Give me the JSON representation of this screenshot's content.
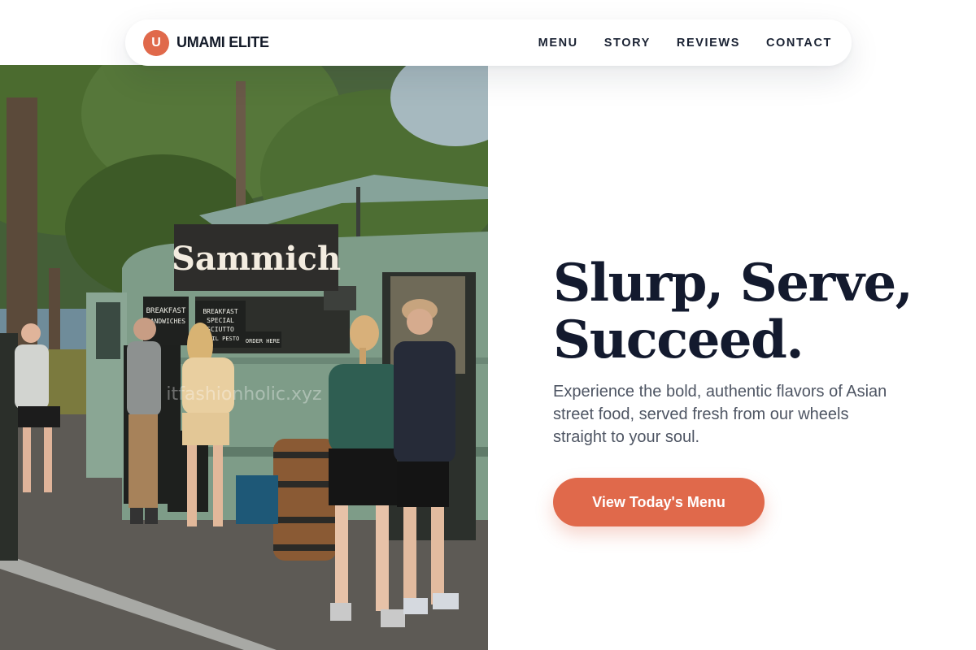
{
  "brand": {
    "mark": "U",
    "name": "UMAMI ELITE"
  },
  "nav": {
    "items": [
      {
        "label": "MENU"
      },
      {
        "label": "STORY"
      },
      {
        "label": "REVIEWS"
      },
      {
        "label": "CONTACT"
      }
    ]
  },
  "hero": {
    "title_line1": "Slurp, Serve,",
    "title_line2": "Succeed.",
    "subtitle": "Experience the bold, authentic flavors of Asian street food, served fresh from our wheels straight to your soul.",
    "cta_label": "View Today's Menu",
    "image": {
      "sign_text": "Sammich",
      "chalkboard1": [
        "BREAKFAST",
        "SANDWICHES"
      ],
      "chalkboard2": [
        "BREAKFAST",
        "SPECIAL",
        "SCIUTTO",
        "BASIL PESTO"
      ],
      "order_sign": "ORDER HERE",
      "watermark": "itfashionholic.xyz"
    }
  },
  "colors": {
    "accent": "#e0694b",
    "heading": "#131a2e",
    "body_text": "#4e5563",
    "truck_green": "#7e9c88"
  }
}
